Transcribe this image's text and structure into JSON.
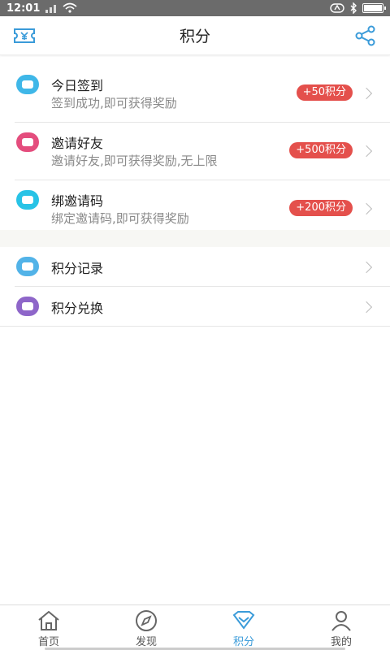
{
  "status_bar": {
    "time": "12:01"
  },
  "header": {
    "title": "积分"
  },
  "tasks": [
    {
      "title": "今日签到",
      "desc": "签到成功,即可获得奖励",
      "badge": "+50积分",
      "icon_color": "#3fb7e8",
      "icon": "calendar-icon"
    },
    {
      "title": "邀请好友",
      "desc": "邀请好友,即可获得奖励,无上限",
      "badge": "+500积分",
      "icon_color": "#e44d7d",
      "icon": "flower-icon"
    },
    {
      "title": "绑邀请码",
      "desc": "绑定邀请码,即可获得奖励",
      "badge": "+200积分",
      "icon_color": "#28c3e6",
      "icon": "bag-icon"
    }
  ],
  "links": [
    {
      "title": "积分记录",
      "icon_color": "#52b3e8",
      "icon": "record-icon"
    },
    {
      "title": "积分兑换",
      "icon_color": "#8e66c9",
      "icon": "exchange-icon"
    }
  ],
  "tabs": [
    {
      "label": "首页",
      "icon": "home-icon"
    },
    {
      "label": "发现",
      "icon": "compass-icon"
    },
    {
      "label": "积分",
      "icon": "diamond-icon"
    },
    {
      "label": "我的",
      "icon": "user-icon"
    }
  ],
  "colors": {
    "accent": "#3a9bd9",
    "badge": "#e4504c"
  }
}
